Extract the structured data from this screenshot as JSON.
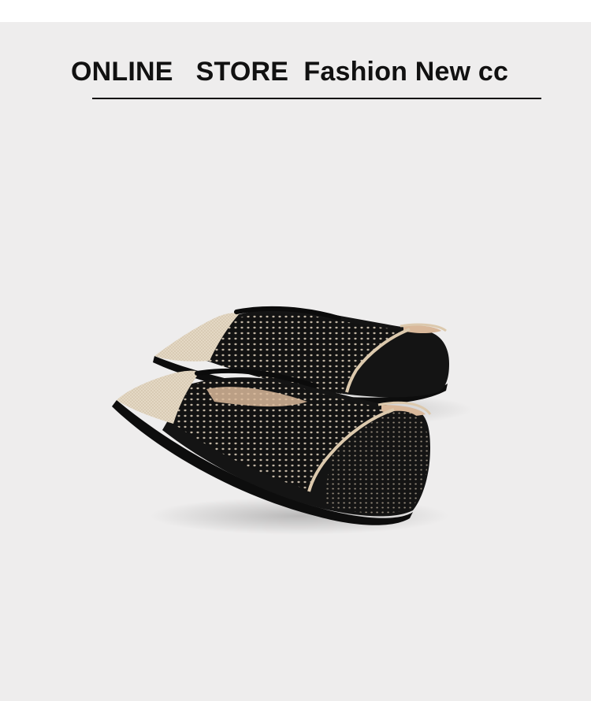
{
  "header": {
    "title": "ONLINE   STORE  Fashion New cc"
  },
  "colors": {
    "background": "#eeeded",
    "text": "#111111",
    "shoe_black": "#141414",
    "toe_beige": "#e6dac6",
    "trim_beige": "#dcc9ad",
    "insole": "#d9b89a"
  },
  "photo": {
    "subject": "pair-of-pointed-toe-knit-flats"
  }
}
